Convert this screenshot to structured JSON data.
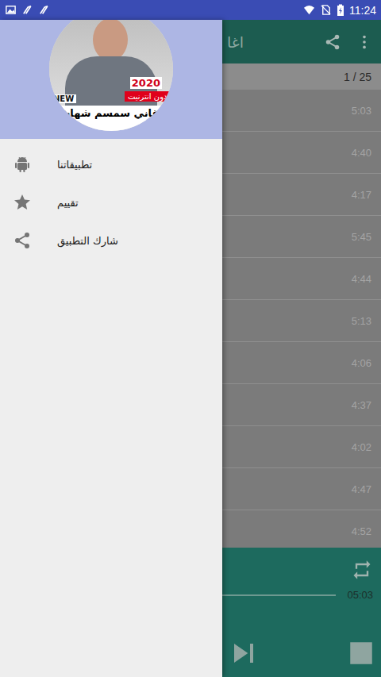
{
  "status_bar": {
    "time": "11:24"
  },
  "app_bar": {
    "title": "اغا"
  },
  "counter": "1 / 25",
  "tracks": [
    {
      "duration": "5:03"
    },
    {
      "duration": "4:40"
    },
    {
      "duration": "4:17"
    },
    {
      "duration": "5:45"
    },
    {
      "duration": "4:44"
    },
    {
      "duration": "5:13"
    },
    {
      "duration": "4:06"
    },
    {
      "duration": "4:37"
    },
    {
      "duration": "4:02"
    },
    {
      "duration": "4:47"
    },
    {
      "duration": "4:52"
    }
  ],
  "player": {
    "total_time": "05:03",
    "level": 0
  },
  "drawer": {
    "header": {
      "year": "2020",
      "offline": "بدون انترنيت",
      "badge": "NEW",
      "title": "اغاني سمسم شهاب"
    },
    "items": [
      {
        "label": "تطبيقاتنا"
      },
      {
        "label": "تقييم"
      },
      {
        "label": "شارك التطبيق"
      }
    ]
  }
}
